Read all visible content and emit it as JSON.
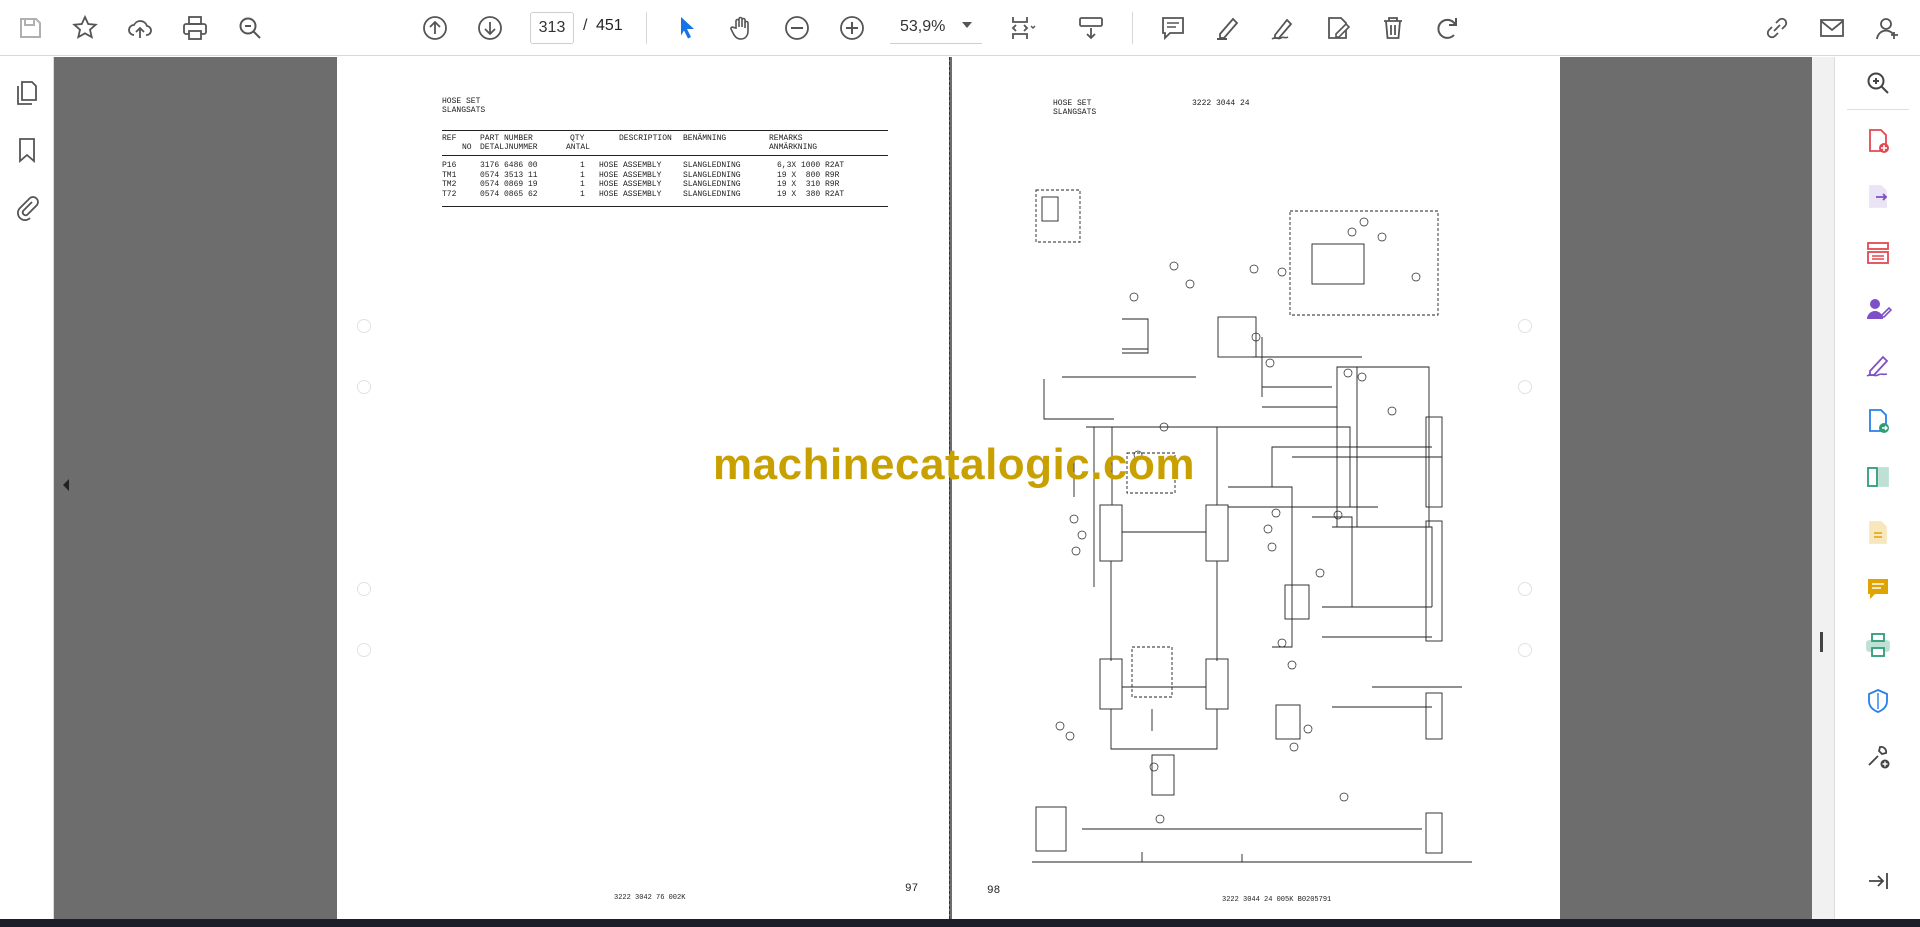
{
  "toolbar": {
    "current_page": "313",
    "page_separator": "/",
    "total_pages": "451",
    "zoom": "53,9%",
    "icons": [
      "save-icon",
      "bookmark-star-icon",
      "upload-cloud-icon",
      "print-icon",
      "find-icon",
      "previous-page-icon",
      "next-page-icon",
      "select-arrow-icon",
      "hand-icon",
      "zoom-out-icon",
      "zoom-in-icon",
      "page-fit-icon",
      "scroll-mode-icon",
      "comment-icon",
      "highlight-icon",
      "sign-icon",
      "fill-sign-icon",
      "delete-icon",
      "rotate-icon",
      "share-link-icon",
      "email-icon",
      "account-icon"
    ]
  },
  "left_rail": {
    "icons": [
      "page-thumbnails-icon",
      "bookmarks-icon",
      "attachments-icon"
    ]
  },
  "right_rail": {
    "icons": [
      "zoom-search-icon",
      "create-pdf-icon",
      "export-pdf-icon",
      "organize-pages-icon",
      "request-signature-icon",
      "fill-and-sign-icon",
      "send-for-review-icon",
      "compare-icon",
      "edit-pdf-icon",
      "comment-tool-icon",
      "print-production-icon",
      "protect-icon",
      "more-tools-icon",
      "expand-panel-icon"
    ]
  },
  "left_page": {
    "heading_line1": "HOSE SET",
    "heading_line2": "SLANGSATS",
    "columns": [
      {
        "line1": "REF",
        "line2": "NO"
      },
      {
        "line1": "PART NUMBER",
        "line2": "DETALJNUMMER"
      },
      {
        "line1": "QTY",
        "line2": "ANTAL"
      },
      {
        "line1": "DESCRIPTION",
        "line2": ""
      },
      {
        "line1": "BENÄMNING",
        "line2": ""
      },
      {
        "line1": "REMARKS",
        "line2": "ANMÄRKNING"
      }
    ],
    "rows": [
      {
        "ref": "P16",
        "part": "3176 6486 00",
        "qty": "1",
        "desc": "HOSE ASSEMBLY",
        "ben": "SLANGLEDNING",
        "rem": "6,3X 1000 R2AT"
      },
      {
        "ref": "TM1",
        "part": "0574 3513 11",
        "qty": "1",
        "desc": "HOSE ASSEMBLY",
        "ben": "SLANGLEDNING",
        "rem": "19 X  800 R9R"
      },
      {
        "ref": "TM2",
        "part": "0574 0869 19",
        "qty": "1",
        "desc": "HOSE ASSEMBLY",
        "ben": "SLANGLEDNING",
        "rem": "19 X  310 R9R"
      },
      {
        "ref": "T72",
        "part": "0574 0865 62",
        "qty": "1",
        "desc": "HOSE ASSEMBLY",
        "ben": "SLANGLEDNING",
        "rem": "19 X  380 R2AT"
      }
    ],
    "page_number": "97",
    "footer": "3222 3042 76  002K"
  },
  "right_page": {
    "heading_line1": "HOSE SET",
    "heading_line2": "SLANGSATS",
    "doc_number": "3222 3044 24",
    "page_number": "98",
    "footer": "3222 3044 24  005K  B0205791"
  },
  "watermark": "machinecatalogic.com",
  "colors": {
    "accent": "#1473e6",
    "viewer_bg": "#6d6d6d",
    "watermark": "#c8a000",
    "tool_red": "#e34850",
    "tool_purple": "#7d50c8",
    "tool_green": "#2d9d78",
    "tool_yellow": "#e0a400"
  }
}
